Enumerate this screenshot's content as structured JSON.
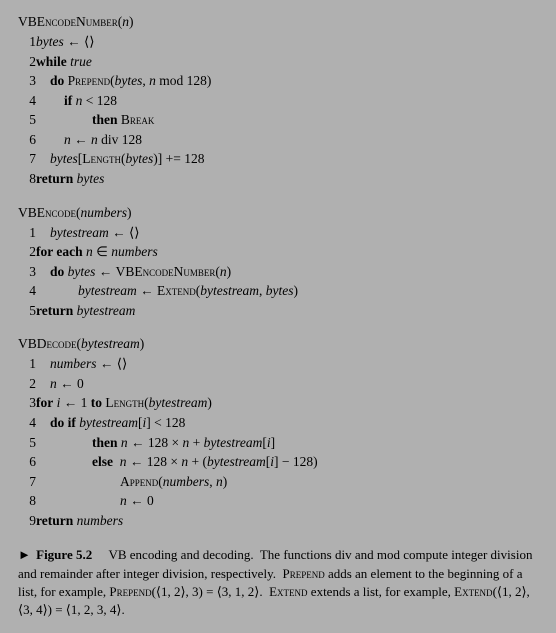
{
  "algorithms": [
    {
      "id": "vbencodenumber",
      "title": "VBEncodeNumber",
      "param": "n",
      "lines": [
        {
          "num": "1",
          "indent": 0,
          "html": "<span class='it'>bytes</span> ← ⟨⟩"
        },
        {
          "num": "2",
          "indent": 0,
          "html": "<span class='kw-bold'>while</span> <span class='it'>true</span>"
        },
        {
          "num": "3",
          "indent": 1,
          "html": "<span class='kw-bold'>do</span> <span class='kw-sc'>Prepend</span>(<span class='it'>bytes</span>, <span class='it'>n</span> mod 128)"
        },
        {
          "num": "4",
          "indent": 2,
          "html": "<span class='kw-bold'>if</span> <span class='it'>n</span> &lt; 128"
        },
        {
          "num": "5",
          "indent": 3,
          "html": "<span class='kw-bold'>then</span> <span class='kw-sc'>Break</span>"
        },
        {
          "num": "6",
          "indent": 2,
          "html": "<span class='it'>n</span> ← <span class='it'>n</span> div 128"
        },
        {
          "num": "7",
          "indent": 1,
          "html": "<span class='it'>bytes</span>[<span class='kw-sc'>Length</span>(<span class='it'>bytes</span>)] +<span>= 128</span>"
        },
        {
          "num": "8",
          "indent": 0,
          "html": "<span class='kw-bold'>return</span> <span class='it'>bytes</span>"
        }
      ]
    },
    {
      "id": "vbencode",
      "title": "VBEncode",
      "param": "numbers",
      "lines": [
        {
          "num": "1",
          "indent": 0,
          "html": "<span class='it'>bytestream</span> ← ⟨⟩"
        },
        {
          "num": "2",
          "indent": 0,
          "html": "<span class='kw-bold'>for each</span> <span class='it'>n</span> ∈ <span class='it'>numbers</span>"
        },
        {
          "num": "3",
          "indent": 1,
          "html": "<span class='kw-bold'>do</span> <span class='it'>bytes</span> ← <span class='kw-sc'>VBEncodeNumber</span>(<span class='it'>n</span>)"
        },
        {
          "num": "4",
          "indent": 2,
          "html": "<span class='it'>bytestream</span> ← <span class='kw-sc'>Extend</span>(<span class='it'>bytestream</span>, <span class='it'>bytes</span>)"
        },
        {
          "num": "5",
          "indent": 0,
          "html": "<span class='kw-bold'>return</span> <span class='it'>bytestream</span>"
        }
      ]
    },
    {
      "id": "vbdecode",
      "title": "VBDecode",
      "param": "bytestream",
      "lines": [
        {
          "num": "1",
          "indent": 0,
          "html": "<span class='it'>numbers</span> ← ⟨⟩"
        },
        {
          "num": "2",
          "indent": 0,
          "html": "<span class='it'>n</span> ← 0"
        },
        {
          "num": "3",
          "indent": 0,
          "html": "<span class='kw-bold'>for</span> <span class='it'>i</span> ← 1 <span class='kw-bold'>to</span> <span class='kw-sc'>Length</span>(<span class='it'>bytestream</span>)"
        },
        {
          "num": "4",
          "indent": 1,
          "html": "<span class='kw-bold'>do if</span> <span class='it'>bytestream</span>[<span class='it'>i</span>] &lt; 128"
        },
        {
          "num": "5",
          "indent": 3,
          "html": "<span class='kw-bold'>then</span> <span class='it'>n</span> ← 128 × <span class='it'>n</span> + <span class='it'>bytestream</span>[<span class='it'>i</span>]"
        },
        {
          "num": "6",
          "indent": 3,
          "html": "<span class='kw-bold'>else</span> &nbsp;<span class='it'>n</span> ← 128 × <span class='it'>n</span> + (<span class='it'>bytestream</span>[<span class='it'>i</span>] − 128)"
        },
        {
          "num": "7",
          "indent": 4,
          "html": "<span class='kw-sc'>Append</span>(<span class='it'>numbers</span>, <span class='it'>n</span>)"
        },
        {
          "num": "8",
          "indent": 4,
          "html": "<span class='it'>n</span> ← 0"
        },
        {
          "num": "9",
          "indent": 0,
          "html": "<span class='kw-bold'>return</span> <span class='it'>numbers</span>"
        }
      ]
    }
  ],
  "caption": {
    "label": "Figure 5.2",
    "text": "   VB encoding and decoding.  The functions div and mod compute integer division and remainder after integer division, respectively.  Prepend adds an element to the beginning of a list, for example, Prepend(⟨1, 2⟩, 3) = ⟨3, 1, 2⟩.  Extend extends a list, for example, Extend(⟨1, 2⟩, ⟨3, 4⟩) = ⟨1, 2, 3, 4⟩."
  }
}
